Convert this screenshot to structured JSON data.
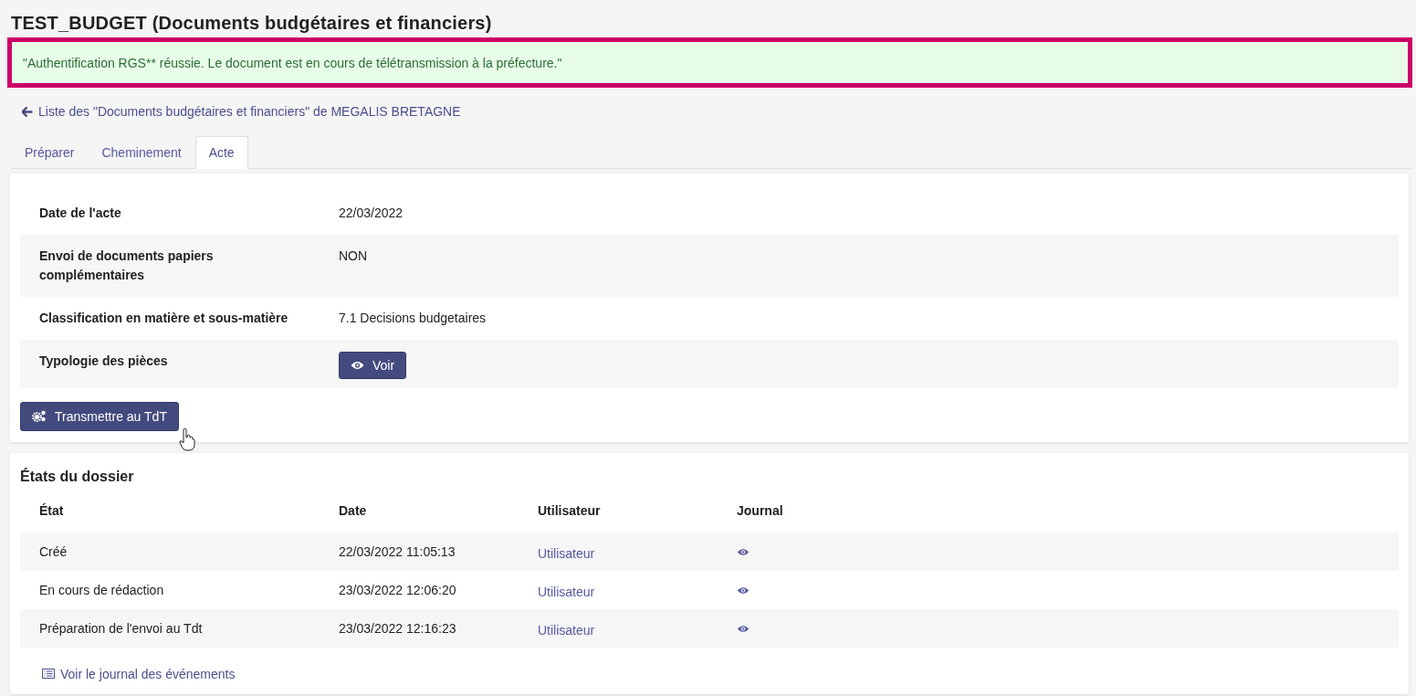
{
  "page_title": "TEST_BUDGET (Documents budgétaires et financiers)",
  "alert": {
    "message": "\"Authentification RGS** réussie. Le document est en cours de télétransmission à la préfecture.\"",
    "highlighted": true
  },
  "back_link": "Liste des \"Documents budgétaires et financiers\" de MEGALIS BRETAGNE",
  "tabs": [
    {
      "label": "Préparer",
      "selected": false
    },
    {
      "label": "Cheminement",
      "selected": false
    },
    {
      "label": "Acte",
      "selected": true
    }
  ],
  "fields": [
    {
      "label": "Date de l'acte",
      "kind": "text",
      "value": "22/03/2022"
    },
    {
      "label": "Envoi de documents papiers complémentaires",
      "kind": "text",
      "value": "NON"
    },
    {
      "label": "Classification en matière et sous-matière",
      "kind": "text",
      "value": "7.1 Decisions budgetaires"
    },
    {
      "label": "Typologie des pièces",
      "kind": "button",
      "value": "Voir"
    }
  ],
  "action_button": "Transmettre au TdT",
  "states": {
    "title": "États du dossier",
    "columns": [
      "État",
      "Date",
      "Utilisateur",
      "Journal"
    ],
    "rows": [
      {
        "state": "Créé",
        "date": "22/03/2022 11:05:13",
        "user": "Utilisateur"
      },
      {
        "state": "En cours de rédaction",
        "date": "23/03/2022 12:06:20",
        "user": "Utilisateur"
      },
      {
        "state": "Préparation de l'envoi au Tdt",
        "date": "23/03/2022 12:16:23",
        "user": "Utilisateur"
      }
    ],
    "journal_link": "Voir le journal des événements"
  }
}
